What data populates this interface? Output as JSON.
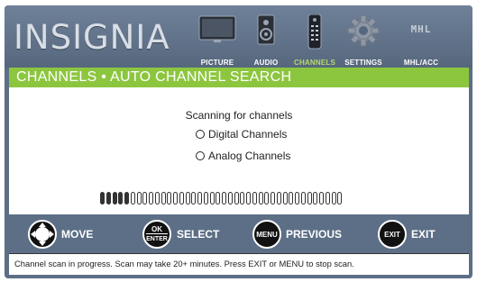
{
  "brand": {
    "logo_text": "INSIGNIA"
  },
  "menu": {
    "items": [
      {
        "label": "PICTURE",
        "icon": "tv-icon",
        "active": false
      },
      {
        "label": "AUDIO",
        "icon": "speaker-icon",
        "active": false
      },
      {
        "label": "CHANNELS",
        "icon": "remote-icon",
        "active": true
      },
      {
        "label": "SETTINGS",
        "icon": "gear-icon",
        "active": false
      },
      {
        "label": "MHL/ACC",
        "icon": "mhl-logo-icon",
        "logo_text": "MHL",
        "active": false
      }
    ]
  },
  "panel": {
    "title": "CHANNELS • AUTO CHANNEL SEARCH",
    "scan_title": "Scanning for channels",
    "options": [
      {
        "label": "Digital Channels"
      },
      {
        "label": "Analog Channels"
      }
    ],
    "progress": {
      "filled_segments": 5,
      "total_segments": 40
    }
  },
  "legend": {
    "move": {
      "button": "",
      "label": "MOVE"
    },
    "select": {
      "button_top": "OK",
      "button_bottom": "ENTER",
      "label": "SELECT"
    },
    "previous": {
      "button": "MENU",
      "label": "PREVIOUS"
    },
    "exit": {
      "button": "EXIT",
      "label": "EXIT"
    }
  },
  "status_text": "Channel scan in progress. Scan may take 20+ minutes. Press EXIT or MENU  to stop scan.",
  "colors": {
    "accent_green": "#8cc63f",
    "background_slate": "#5d6f86",
    "active_label": "#b8d96b"
  }
}
